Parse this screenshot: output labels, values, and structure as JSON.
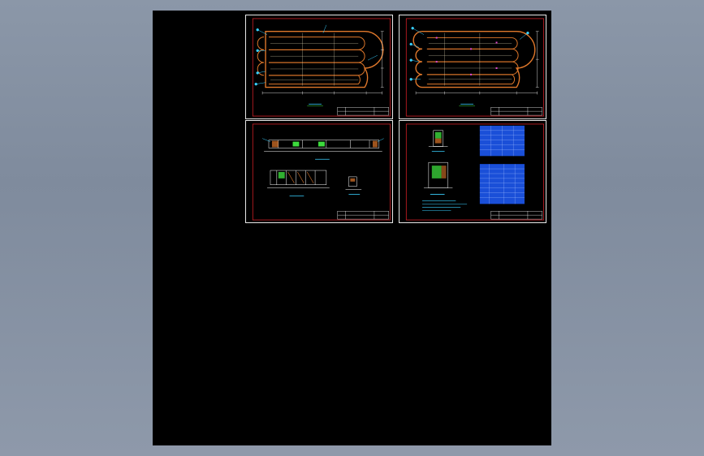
{
  "app": {
    "window_title": ""
  },
  "colors": {
    "background": "#8b97a8",
    "canvas": "#000000",
    "sheet_border": "#e8e8e8",
    "frame": "#d21f26",
    "outline": "#e0782b",
    "dimension": "#ffffff",
    "annotation": "#39d0ff",
    "highlight": "#3ddc3d",
    "table_fill": "#1a4fd8"
  },
  "sheets": [
    {
      "id": "sheet-1",
      "content": "oval-race-plan-a"
    },
    {
      "id": "sheet-2",
      "content": "oval-race-plan-b"
    },
    {
      "id": "sheet-3",
      "content": "sections"
    },
    {
      "id": "sheet-4",
      "content": "details-and-tables"
    }
  ]
}
